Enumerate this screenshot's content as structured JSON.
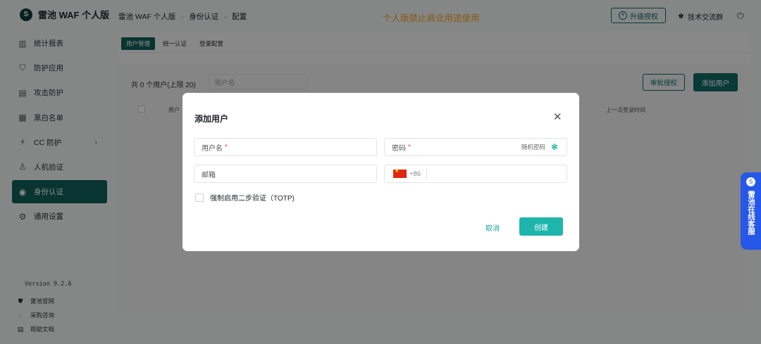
{
  "brand": {
    "logo": "S",
    "name": "雷池 WAF 个人版"
  },
  "sidebar": {
    "items": [
      {
        "icon": "chart-icon",
        "glyph": "▥",
        "label": "统计报表"
      },
      {
        "icon": "shield-icon",
        "glyph": "⛉",
        "label": "防护应用"
      },
      {
        "icon": "doc-icon",
        "glyph": "▤",
        "label": "攻击防护"
      },
      {
        "icon": "list-icon",
        "glyph": "▦",
        "label": "黑白名单"
      },
      {
        "icon": "cc-icon",
        "glyph": "⚡",
        "label": "CC 防护",
        "arrow": "›"
      },
      {
        "icon": "robot-icon",
        "glyph": "♙",
        "label": "人机验证"
      },
      {
        "icon": "id-icon",
        "glyph": "◉",
        "label": "身份认证"
      },
      {
        "icon": "settings-icon",
        "glyph": "⚙",
        "label": "通用设置"
      }
    ],
    "version": "Version 9.2.6",
    "footer": [
      {
        "icon": "shield-icon",
        "glyph": "⛊",
        "label": "雷池官网"
      },
      {
        "icon": "chat-icon",
        "glyph": "◌",
        "label": "采购咨询"
      },
      {
        "icon": "book-icon",
        "glyph": "▤",
        "label": "帮助文档"
      }
    ]
  },
  "header": {
    "breadcrumb": [
      "雷池 WAF 个人版",
      "身份认证",
      "配置"
    ],
    "breadcrumb_sep": "›",
    "notice": "个人版禁止商业用途使用",
    "upgrade_label": "升级授权",
    "upgrade_glyph": "+",
    "community_glyph": "♚",
    "community_label": "技术交流群",
    "logout_glyph": "⏻"
  },
  "main": {
    "tabs": [
      {
        "label": "用户管理",
        "active": true
      },
      {
        "label": "统一认证",
        "active": false
      },
      {
        "label": "登录配置",
        "active": false
      }
    ],
    "count_text": "共 0 个用户(上限 20)",
    "search_placeholder": "用户名",
    "review_label": "审批授权",
    "add_label": "添加用户",
    "columns": [
      "用户",
      "上一次登录时间"
    ]
  },
  "dialog": {
    "title": "添加用户",
    "close_glyph": "✕",
    "username_placeholder": "用户名",
    "password_placeholder": "密码",
    "required_mark": "*",
    "random_password": "随机密码",
    "random_glyph": "❃",
    "email_placeholder": "邮箱",
    "dial_code": "+86",
    "totp_label": "强制启用二步验证（TOTP)",
    "cancel_label": "取消",
    "create_label": "创建"
  },
  "service": {
    "logo": "S",
    "label": "雷池在线客服"
  }
}
